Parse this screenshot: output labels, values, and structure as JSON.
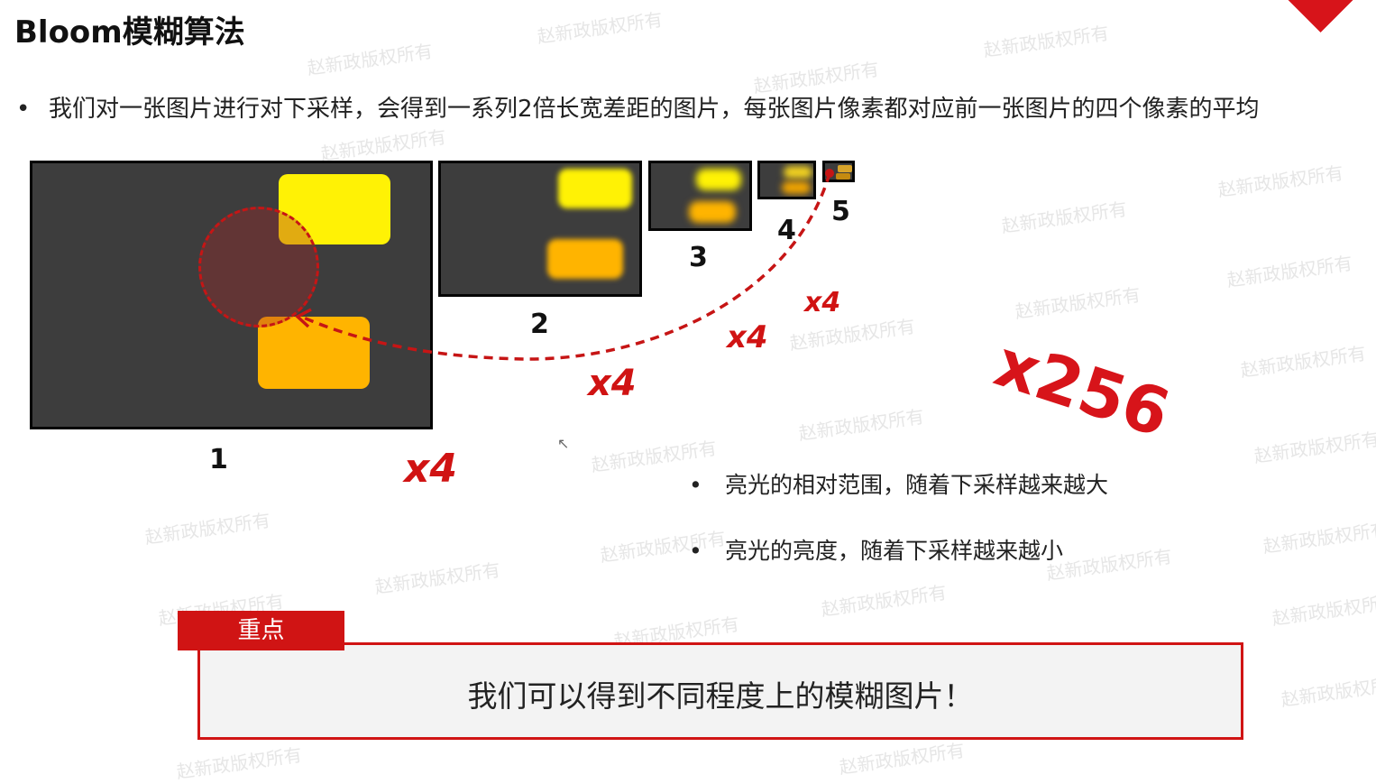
{
  "title": "Bloom模糊算法",
  "intro": {
    "bullet": "•",
    "text": "我们对一张图片进行对下采样，会得到一系列2倍长宽差距的图片，每张图片像素都对应前一张图片的四个像素的平均"
  },
  "labels": [
    "1",
    "2",
    "3",
    "4",
    "5"
  ],
  "multipliers": [
    "x4",
    "x4",
    "x4",
    "x4"
  ],
  "total_multiplier": "x256",
  "points": [
    {
      "bullet": "•",
      "text": "亮光的相对范围，随着下采样越来越大"
    },
    {
      "bullet": "•",
      "text": "亮光的亮度，随着下采样越来越小"
    }
  ],
  "note": {
    "tag": "重点",
    "text": "我们可以得到不同程度上的模糊图片！"
  },
  "watermark": "赵新政版权所有",
  "colors": {
    "accent": "#d7141a",
    "panel_bg": "#3d3d3d",
    "yellow": "#fff205",
    "orange": "#ffb400"
  }
}
